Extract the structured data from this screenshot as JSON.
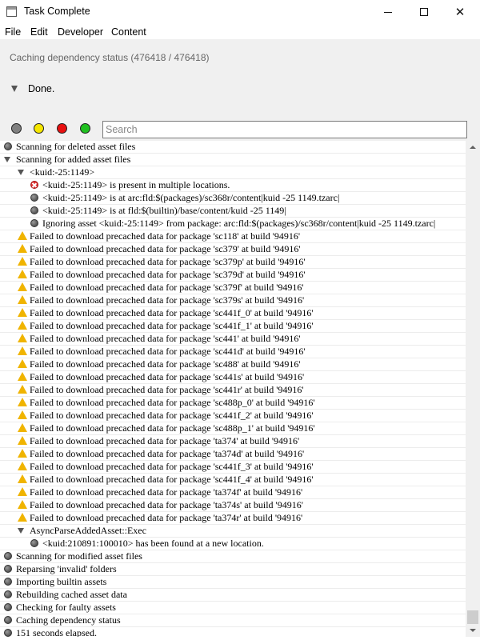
{
  "window": {
    "title": "Task Complete",
    "minimize_glyph": "",
    "maximize_glyph": "",
    "close_glyph": "✕"
  },
  "menu": [
    "File",
    "Edit",
    "Developer",
    "Content"
  ],
  "status": {
    "caching_text": "Caching dependency status (476418 / 476418)",
    "done_text": "Done."
  },
  "filters": [
    {
      "name": "filter-grey-dot",
      "color": "#808080"
    },
    {
      "name": "filter-yellow-dot",
      "color": "#f5e600"
    },
    {
      "name": "filter-red-dot",
      "color": "#e81010"
    },
    {
      "name": "filter-green-dot",
      "color": "#20c020"
    }
  ],
  "search": {
    "placeholder": "Search",
    "value": ""
  },
  "log": [
    {
      "indent": 0,
      "icon": "grey",
      "text": "Scanning for deleted asset files"
    },
    {
      "indent": 0,
      "icon": "tri",
      "text": "Scanning for added asset files"
    },
    {
      "indent": 1,
      "icon": "tri",
      "text": "<kuid:-25:1149>"
    },
    {
      "indent": 2,
      "icon": "error",
      "text": "<kuid:-25:1149> is present in multiple locations."
    },
    {
      "indent": 2,
      "icon": "grey",
      "text": "<kuid:-25:1149> is at arc:fld:$(packages)/sc368r/content|kuid -25 1149.tzarc|"
    },
    {
      "indent": 2,
      "icon": "grey",
      "text": "<kuid:-25:1149> is at fld:$(builtin)/base/content/kuid -25 1149|"
    },
    {
      "indent": 2,
      "icon": "grey",
      "text": "Ignoring asset <kuid:-25:1149> from package: arc:fld:$(packages)/sc368r/content|kuid -25 1149.tzarc|"
    },
    {
      "indent": 1,
      "icon": "warn",
      "text": "Failed to download precached data for package 'sc118' at build '94916'"
    },
    {
      "indent": 1,
      "icon": "warn",
      "text": "Failed to download precached data for package 'sc379' at build '94916'"
    },
    {
      "indent": 1,
      "icon": "warn",
      "text": "Failed to download precached data for package 'sc379p' at build '94916'"
    },
    {
      "indent": 1,
      "icon": "warn",
      "text": "Failed to download precached data for package 'sc379d' at build '94916'"
    },
    {
      "indent": 1,
      "icon": "warn",
      "text": "Failed to download precached data for package 'sc379f' at build '94916'"
    },
    {
      "indent": 1,
      "icon": "warn",
      "text": "Failed to download precached data for package 'sc379s' at build '94916'"
    },
    {
      "indent": 1,
      "icon": "warn",
      "text": "Failed to download precached data for package 'sc441f_0' at build '94916'"
    },
    {
      "indent": 1,
      "icon": "warn",
      "text": "Failed to download precached data for package 'sc441f_1' at build '94916'"
    },
    {
      "indent": 1,
      "icon": "warn",
      "text": "Failed to download precached data for package 'sc441' at build '94916'"
    },
    {
      "indent": 1,
      "icon": "warn",
      "text": "Failed to download precached data for package 'sc441d' at build '94916'"
    },
    {
      "indent": 1,
      "icon": "warn",
      "text": "Failed to download precached data for package 'sc488' at build '94916'"
    },
    {
      "indent": 1,
      "icon": "warn",
      "text": "Failed to download precached data for package 'sc441s' at build '94916'"
    },
    {
      "indent": 1,
      "icon": "warn",
      "text": "Failed to download precached data for package 'sc441r' at build '94916'"
    },
    {
      "indent": 1,
      "icon": "warn",
      "text": "Failed to download precached data for package 'sc488p_0' at build '94916'"
    },
    {
      "indent": 1,
      "icon": "warn",
      "text": "Failed to download precached data for package 'sc441f_2' at build '94916'"
    },
    {
      "indent": 1,
      "icon": "warn",
      "text": "Failed to download precached data for package 'sc488p_1' at build '94916'"
    },
    {
      "indent": 1,
      "icon": "warn",
      "text": "Failed to download precached data for package 'ta374' at build '94916'"
    },
    {
      "indent": 1,
      "icon": "warn",
      "text": "Failed to download precached data for package 'ta374d' at build '94916'"
    },
    {
      "indent": 1,
      "icon": "warn",
      "text": "Failed to download precached data for package 'sc441f_3' at build '94916'"
    },
    {
      "indent": 1,
      "icon": "warn",
      "text": "Failed to download precached data for package 'sc441f_4' at build '94916'"
    },
    {
      "indent": 1,
      "icon": "warn",
      "text": "Failed to download precached data for package 'ta374f' at build '94916'"
    },
    {
      "indent": 1,
      "icon": "warn",
      "text": "Failed to download precached data for package 'ta374s' at build '94916'"
    },
    {
      "indent": 1,
      "icon": "warn",
      "text": "Failed to download precached data for package 'ta374r' at build '94916'"
    },
    {
      "indent": 1,
      "icon": "tri",
      "text": "AsyncParseAddedAsset::Exec"
    },
    {
      "indent": 2,
      "icon": "grey",
      "text": "<kuid:210891:100010> has been found at a new location."
    },
    {
      "indent": 0,
      "icon": "grey",
      "text": "Scanning for modified asset files"
    },
    {
      "indent": 0,
      "icon": "grey",
      "text": "Reparsing 'invalid' folders"
    },
    {
      "indent": 0,
      "icon": "grey",
      "text": "Importing builtin assets"
    },
    {
      "indent": 0,
      "icon": "grey",
      "text": "Rebuilding cached asset data"
    },
    {
      "indent": 0,
      "icon": "grey",
      "text": "Checking for faulty assets"
    },
    {
      "indent": 0,
      "icon": "grey",
      "text": "Caching dependency status"
    },
    {
      "indent": 0,
      "icon": "grey",
      "text": "151 seconds elapsed."
    }
  ]
}
